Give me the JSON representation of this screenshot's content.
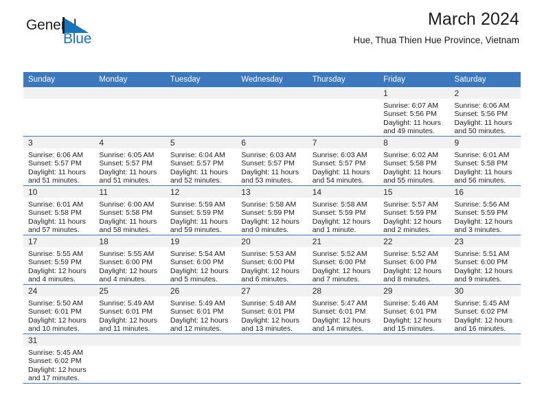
{
  "brand": {
    "name_top": "General",
    "name_bottom": "Blue",
    "flag_color": "#1673bc",
    "text_color": "#231f20"
  },
  "header": {
    "title": "March 2024",
    "subtitle": "Hue, Thua Thien Hue Province, Vietnam"
  },
  "theme": {
    "header_blue": "#3b78be",
    "daynum_gray": "#f1f1f1",
    "grid_line": "#3b78be",
    "text": "#1a1a1a"
  },
  "calendar": {
    "weekday_headers": [
      "Sunday",
      "Monday",
      "Tuesday",
      "Wednesday",
      "Thursday",
      "Friday",
      "Saturday"
    ],
    "weeks": [
      [
        {
          "day": "",
          "sunrise": "",
          "sunset": "",
          "daylight_line1": "",
          "daylight_line2": ""
        },
        {
          "day": "",
          "sunrise": "",
          "sunset": "",
          "daylight_line1": "",
          "daylight_line2": ""
        },
        {
          "day": "",
          "sunrise": "",
          "sunset": "",
          "daylight_line1": "",
          "daylight_line2": ""
        },
        {
          "day": "",
          "sunrise": "",
          "sunset": "",
          "daylight_line1": "",
          "daylight_line2": ""
        },
        {
          "day": "",
          "sunrise": "",
          "sunset": "",
          "daylight_line1": "",
          "daylight_line2": ""
        },
        {
          "day": "1",
          "sunrise": "Sunrise: 6:07 AM",
          "sunset": "Sunset: 5:56 PM",
          "daylight_line1": "Daylight: 11 hours",
          "daylight_line2": "and 49 minutes."
        },
        {
          "day": "2",
          "sunrise": "Sunrise: 6:06 AM",
          "sunset": "Sunset: 5:56 PM",
          "daylight_line1": "Daylight: 11 hours",
          "daylight_line2": "and 50 minutes."
        }
      ],
      [
        {
          "day": "3",
          "sunrise": "Sunrise: 6:06 AM",
          "sunset": "Sunset: 5:57 PM",
          "daylight_line1": "Daylight: 11 hours",
          "daylight_line2": "and 51 minutes."
        },
        {
          "day": "4",
          "sunrise": "Sunrise: 6:05 AM",
          "sunset": "Sunset: 5:57 PM",
          "daylight_line1": "Daylight: 11 hours",
          "daylight_line2": "and 51 minutes."
        },
        {
          "day": "5",
          "sunrise": "Sunrise: 6:04 AM",
          "sunset": "Sunset: 5:57 PM",
          "daylight_line1": "Daylight: 11 hours",
          "daylight_line2": "and 52 minutes."
        },
        {
          "day": "6",
          "sunrise": "Sunrise: 6:03 AM",
          "sunset": "Sunset: 5:57 PM",
          "daylight_line1": "Daylight: 11 hours",
          "daylight_line2": "and 53 minutes."
        },
        {
          "day": "7",
          "sunrise": "Sunrise: 6:03 AM",
          "sunset": "Sunset: 5:57 PM",
          "daylight_line1": "Daylight: 11 hours",
          "daylight_line2": "and 54 minutes."
        },
        {
          "day": "8",
          "sunrise": "Sunrise: 6:02 AM",
          "sunset": "Sunset: 5:58 PM",
          "daylight_line1": "Daylight: 11 hours",
          "daylight_line2": "and 55 minutes."
        },
        {
          "day": "9",
          "sunrise": "Sunrise: 6:01 AM",
          "sunset": "Sunset: 5:58 PM",
          "daylight_line1": "Daylight: 11 hours",
          "daylight_line2": "and 56 minutes."
        }
      ],
      [
        {
          "day": "10",
          "sunrise": "Sunrise: 6:01 AM",
          "sunset": "Sunset: 5:58 PM",
          "daylight_line1": "Daylight: 11 hours",
          "daylight_line2": "and 57 minutes."
        },
        {
          "day": "11",
          "sunrise": "Sunrise: 6:00 AM",
          "sunset": "Sunset: 5:58 PM",
          "daylight_line1": "Daylight: 11 hours",
          "daylight_line2": "and 58 minutes."
        },
        {
          "day": "12",
          "sunrise": "Sunrise: 5:59 AM",
          "sunset": "Sunset: 5:59 PM",
          "daylight_line1": "Daylight: 11 hours",
          "daylight_line2": "and 59 minutes."
        },
        {
          "day": "13",
          "sunrise": "Sunrise: 5:58 AM",
          "sunset": "Sunset: 5:59 PM",
          "daylight_line1": "Daylight: 12 hours",
          "daylight_line2": "and 0 minutes."
        },
        {
          "day": "14",
          "sunrise": "Sunrise: 5:58 AM",
          "sunset": "Sunset: 5:59 PM",
          "daylight_line1": "Daylight: 12 hours",
          "daylight_line2": "and 1 minute."
        },
        {
          "day": "15",
          "sunrise": "Sunrise: 5:57 AM",
          "sunset": "Sunset: 5:59 PM",
          "daylight_line1": "Daylight: 12 hours",
          "daylight_line2": "and 2 minutes."
        },
        {
          "day": "16",
          "sunrise": "Sunrise: 5:56 AM",
          "sunset": "Sunset: 5:59 PM",
          "daylight_line1": "Daylight: 12 hours",
          "daylight_line2": "and 3 minutes."
        }
      ],
      [
        {
          "day": "17",
          "sunrise": "Sunrise: 5:55 AM",
          "sunset": "Sunset: 5:59 PM",
          "daylight_line1": "Daylight: 12 hours",
          "daylight_line2": "and 4 minutes."
        },
        {
          "day": "18",
          "sunrise": "Sunrise: 5:55 AM",
          "sunset": "Sunset: 6:00 PM",
          "daylight_line1": "Daylight: 12 hours",
          "daylight_line2": "and 4 minutes."
        },
        {
          "day": "19",
          "sunrise": "Sunrise: 5:54 AM",
          "sunset": "Sunset: 6:00 PM",
          "daylight_line1": "Daylight: 12 hours",
          "daylight_line2": "and 5 minutes."
        },
        {
          "day": "20",
          "sunrise": "Sunrise: 5:53 AM",
          "sunset": "Sunset: 6:00 PM",
          "daylight_line1": "Daylight: 12 hours",
          "daylight_line2": "and 6 minutes."
        },
        {
          "day": "21",
          "sunrise": "Sunrise: 5:52 AM",
          "sunset": "Sunset: 6:00 PM",
          "daylight_line1": "Daylight: 12 hours",
          "daylight_line2": "and 7 minutes."
        },
        {
          "day": "22",
          "sunrise": "Sunrise: 5:52 AM",
          "sunset": "Sunset: 6:00 PM",
          "daylight_line1": "Daylight: 12 hours",
          "daylight_line2": "and 8 minutes."
        },
        {
          "day": "23",
          "sunrise": "Sunrise: 5:51 AM",
          "sunset": "Sunset: 6:00 PM",
          "daylight_line1": "Daylight: 12 hours",
          "daylight_line2": "and 9 minutes."
        }
      ],
      [
        {
          "day": "24",
          "sunrise": "Sunrise: 5:50 AM",
          "sunset": "Sunset: 6:01 PM",
          "daylight_line1": "Daylight: 12 hours",
          "daylight_line2": "and 10 minutes."
        },
        {
          "day": "25",
          "sunrise": "Sunrise: 5:49 AM",
          "sunset": "Sunset: 6:01 PM",
          "daylight_line1": "Daylight: 12 hours",
          "daylight_line2": "and 11 minutes."
        },
        {
          "day": "26",
          "sunrise": "Sunrise: 5:49 AM",
          "sunset": "Sunset: 6:01 PM",
          "daylight_line1": "Daylight: 12 hours",
          "daylight_line2": "and 12 minutes."
        },
        {
          "day": "27",
          "sunrise": "Sunrise: 5:48 AM",
          "sunset": "Sunset: 6:01 PM",
          "daylight_line1": "Daylight: 12 hours",
          "daylight_line2": "and 13 minutes."
        },
        {
          "day": "28",
          "sunrise": "Sunrise: 5:47 AM",
          "sunset": "Sunset: 6:01 PM",
          "daylight_line1": "Daylight: 12 hours",
          "daylight_line2": "and 14 minutes."
        },
        {
          "day": "29",
          "sunrise": "Sunrise: 5:46 AM",
          "sunset": "Sunset: 6:01 PM",
          "daylight_line1": "Daylight: 12 hours",
          "daylight_line2": "and 15 minutes."
        },
        {
          "day": "30",
          "sunrise": "Sunrise: 5:45 AM",
          "sunset": "Sunset: 6:02 PM",
          "daylight_line1": "Daylight: 12 hours",
          "daylight_line2": "and 16 minutes."
        }
      ],
      [
        {
          "day": "31",
          "sunrise": "Sunrise: 5:45 AM",
          "sunset": "Sunset: 6:02 PM",
          "daylight_line1": "Daylight: 12 hours",
          "daylight_line2": "and 17 minutes."
        },
        {
          "day": "",
          "sunrise": "",
          "sunset": "",
          "daylight_line1": "",
          "daylight_line2": ""
        },
        {
          "day": "",
          "sunrise": "",
          "sunset": "",
          "daylight_line1": "",
          "daylight_line2": ""
        },
        {
          "day": "",
          "sunrise": "",
          "sunset": "",
          "daylight_line1": "",
          "daylight_line2": ""
        },
        {
          "day": "",
          "sunrise": "",
          "sunset": "",
          "daylight_line1": "",
          "daylight_line2": ""
        },
        {
          "day": "",
          "sunrise": "",
          "sunset": "",
          "daylight_line1": "",
          "daylight_line2": ""
        },
        {
          "day": "",
          "sunrise": "",
          "sunset": "",
          "daylight_line1": "",
          "daylight_line2": ""
        }
      ]
    ]
  }
}
